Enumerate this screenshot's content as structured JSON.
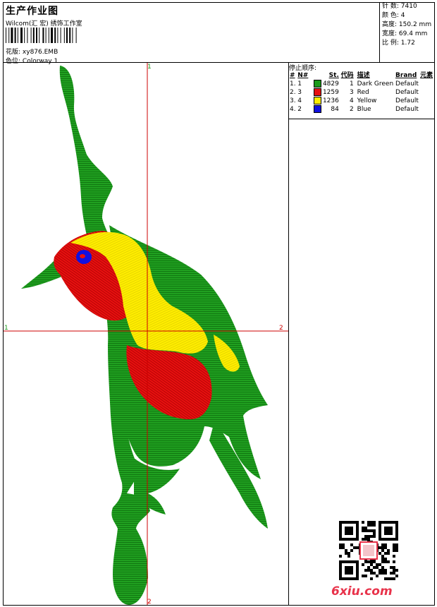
{
  "header": {
    "title": "生产作业图",
    "company": "Wilcom(汇 宏) 绣饰工作室",
    "design_label": "花版:",
    "design_value": "xy876.EMB",
    "colorway_label": "色位:",
    "colorway_value": "Colorway 1"
  },
  "stats": [
    {
      "label": "针 数:",
      "value": "7410"
    },
    {
      "label": "颜 色:",
      "value": "4"
    },
    {
      "label": "高度:",
      "value": "150.2 mm"
    },
    {
      "label": "宽度:",
      "value": "69.4 mm"
    },
    {
      "label": "比 例:",
      "value": "1.72"
    }
  ],
  "stop_sequence": {
    "caption": "停止顺序:",
    "headers": [
      "#",
      "N#",
      "St.",
      "代码",
      "描述",
      "Brand",
      "元素"
    ],
    "rows": [
      {
        "idx": "1.",
        "n": "1",
        "st": "4829",
        "code": "1",
        "desc": "Dark Green",
        "brand": "Default",
        "color": "#1a9a1a"
      },
      {
        "idx": "2.",
        "n": "3",
        "st": "1259",
        "code": "3",
        "desc": "Red",
        "brand": "Default",
        "color": "#e81010"
      },
      {
        "idx": "3.",
        "n": "4",
        "st": "1236",
        "code": "4",
        "desc": "Yellow",
        "brand": "Default",
        "color": "#ffee00"
      },
      {
        "idx": "4.",
        "n": "2",
        "st": "84",
        "code": "2",
        "desc": "Blue",
        "brand": "Default",
        "color": "#1010e0"
      }
    ]
  },
  "crosshair": {
    "top": "1",
    "left": "1",
    "right": "2",
    "bottom": "2"
  },
  "watermark": "6xiu.com",
  "colors": {
    "green": "#1a9a1a",
    "red": "#e81010",
    "yellow": "#ffee00",
    "blue": "#1010e0",
    "axis": "#cc0000"
  }
}
